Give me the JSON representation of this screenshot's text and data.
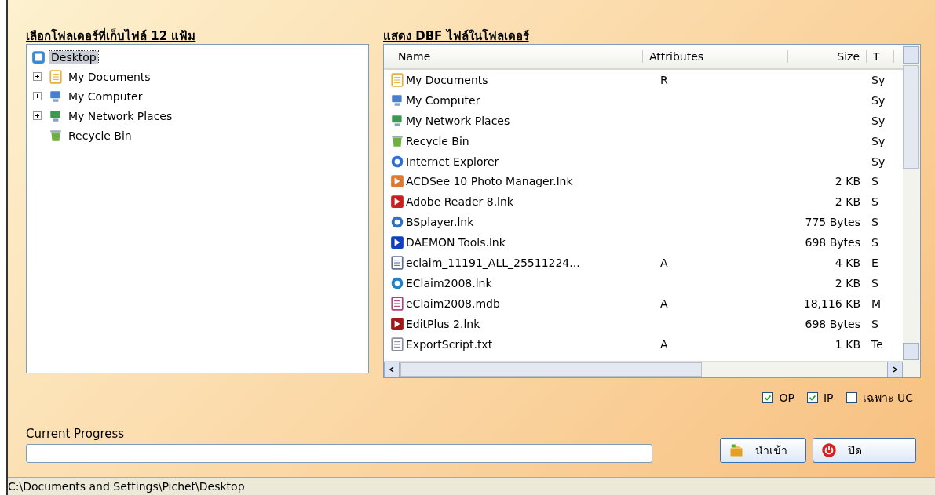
{
  "left_heading": "เลือกโฟลเดอร์ที่เก็บไฟล์ 12 แฟ้ม",
  "right_heading": "แสดง DBF ไฟล์ในโฟลเดอร์",
  "tree": [
    {
      "label": "Desktop",
      "kind": "desktop",
      "selected": true,
      "children": [
        {
          "label": "My Documents",
          "kind": "documents",
          "selected": false,
          "expanded": false
        },
        {
          "label": "My Computer",
          "kind": "computer",
          "selected": false,
          "expanded": false
        },
        {
          "label": "My Network Places",
          "kind": "network",
          "selected": false,
          "expanded": false
        },
        {
          "label": "Recycle Bin",
          "kind": "recycle",
          "selected": false
        }
      ]
    }
  ],
  "file_list": {
    "columns": [
      "Name",
      "Attributes",
      "Size",
      "T"
    ],
    "rows": [
      {
        "kind": "documents",
        "name": "My Documents",
        "attributes": "R",
        "size": "",
        "type": "Sy"
      },
      {
        "kind": "computer",
        "name": "My Computer",
        "attributes": "",
        "size": "",
        "type": "Sy"
      },
      {
        "kind": "network",
        "name": "My Network Places",
        "attributes": "",
        "size": "",
        "type": "Sy"
      },
      {
        "kind": "recycle",
        "name": "Recycle Bin",
        "attributes": "",
        "size": "",
        "type": "Sy"
      },
      {
        "kind": "browser",
        "name": "Internet Explorer",
        "attributes": "",
        "size": "",
        "type": "Sy"
      },
      {
        "kind": "photo",
        "name": "ACDSee 10 Photo Manager.lnk",
        "attributes": "",
        "size": "2 KB",
        "type": "S"
      },
      {
        "kind": "pdf",
        "name": "Adobe Reader 8.lnk",
        "attributes": "",
        "size": "2 KB",
        "type": "S"
      },
      {
        "kind": "player",
        "name": "BSplayer.lnk",
        "attributes": "",
        "size": "775 Bytes",
        "type": "S"
      },
      {
        "kind": "bolt",
        "name": "DAEMON Tools.lnk",
        "attributes": "",
        "size": "698 Bytes",
        "type": "S"
      },
      {
        "kind": "window",
        "name": "eclaim_11191_ALL_25511224...",
        "attributes": "A",
        "size": "4 KB",
        "type": "E"
      },
      {
        "kind": "app",
        "name": "EClaim2008.lnk",
        "attributes": "",
        "size": "2 KB",
        "type": "S"
      },
      {
        "kind": "database",
        "name": "eClaim2008.mdb",
        "attributes": "A",
        "size": "18,116 KB",
        "type": "M"
      },
      {
        "kind": "notebook",
        "name": "EditPlus 2.lnk",
        "attributes": "",
        "size": "698 Bytes",
        "type": "S"
      },
      {
        "kind": "text",
        "name": "ExportScript.txt",
        "attributes": "A",
        "size": "1 KB",
        "type": "Te"
      }
    ]
  },
  "options": [
    {
      "label": "OP",
      "checked": true
    },
    {
      "label": "IP",
      "checked": true
    },
    {
      "label": "เฉพาะ UC",
      "checked": false
    }
  ],
  "progress": {
    "label": "Current Progress",
    "level": 0
  },
  "buttons": [
    {
      "label": "นำเข้า",
      "kind": "import"
    },
    {
      "label": "ปิด",
      "kind": "close"
    }
  ],
  "status_bar": "C:\\Documents and Settings\\Pichet\\Desktop"
}
